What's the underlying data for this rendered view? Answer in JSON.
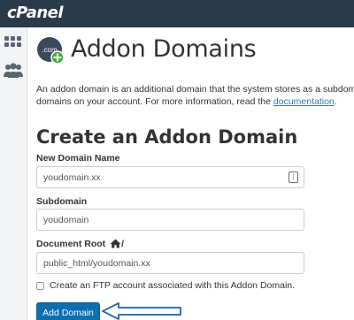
{
  "app": {
    "logo_text": "cPanel",
    "topbar_color": "#293a4a",
    "accent_color": "#0d6eb0"
  },
  "sidebar": {
    "items": [
      {
        "icon": "grid-icon"
      },
      {
        "icon": "users-icon"
      }
    ]
  },
  "page": {
    "title": "Addon Domains",
    "icon": "com-addon-icon",
    "icon_text": ".com"
  },
  "description": {
    "line1": "An addon domain is an additional domain that the system stores as a subdomain",
    "line2_prefix": "domains on your account. For more information, read the ",
    "link_text": "documentation",
    "line2_suffix": "."
  },
  "form": {
    "section_title": "Create an Addon Domain",
    "new_domain_label": "New Domain Name",
    "new_domain_value": "youdomain.xx",
    "subdomain_label": "Subdomain",
    "subdomain_value": "youdomain",
    "docroot_label": "Document Root",
    "docroot_suffix": "/",
    "docroot_value": "public_html/youdomain.xx",
    "ftp_checkbox_label": "Create an FTP account associated with this Addon Domain.",
    "ftp_checked": false,
    "submit_label": "Add Domain"
  },
  "annotation": {
    "arrow_color": "#1f5fa8"
  }
}
